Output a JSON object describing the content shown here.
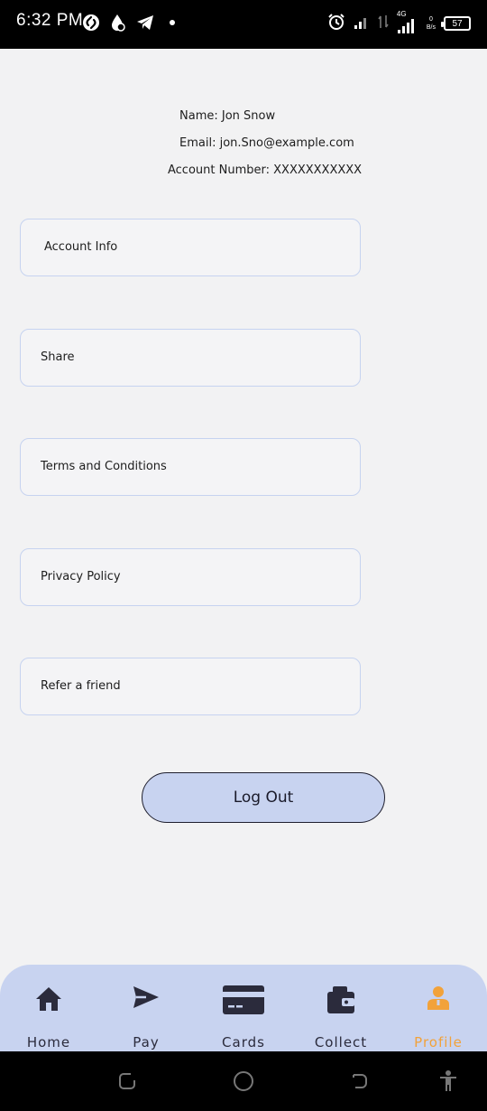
{
  "status_bar": {
    "time": "6:32 PM",
    "network": "4G",
    "data_speed_top": "0",
    "data_speed_unit": "B/s",
    "battery": "57"
  },
  "profile": {
    "name": "Name: Jon Snow",
    "email": "Email: jon.Sno@example.com",
    "account_number": "Account Number: XXXXXXXXXXX"
  },
  "menu": {
    "items": [
      {
        "label": "Account Info"
      },
      {
        "label": "Share"
      },
      {
        "label": "Terms and Conditions"
      },
      {
        "label": "Privacy Policy"
      },
      {
        "label": "Refer a friend"
      }
    ]
  },
  "logout_label": "Log Out",
  "bottom_nav": {
    "items": [
      {
        "label": "Home",
        "icon": "home-icon"
      },
      {
        "label": "Pay",
        "icon": "send-icon"
      },
      {
        "label": "Cards",
        "icon": "card-icon"
      },
      {
        "label": "Collect",
        "icon": "wallet-icon"
      },
      {
        "label": "Profile",
        "icon": "person-icon",
        "active": true
      }
    ],
    "active_color": "#f2a23a",
    "background": "#c8d3f0"
  }
}
